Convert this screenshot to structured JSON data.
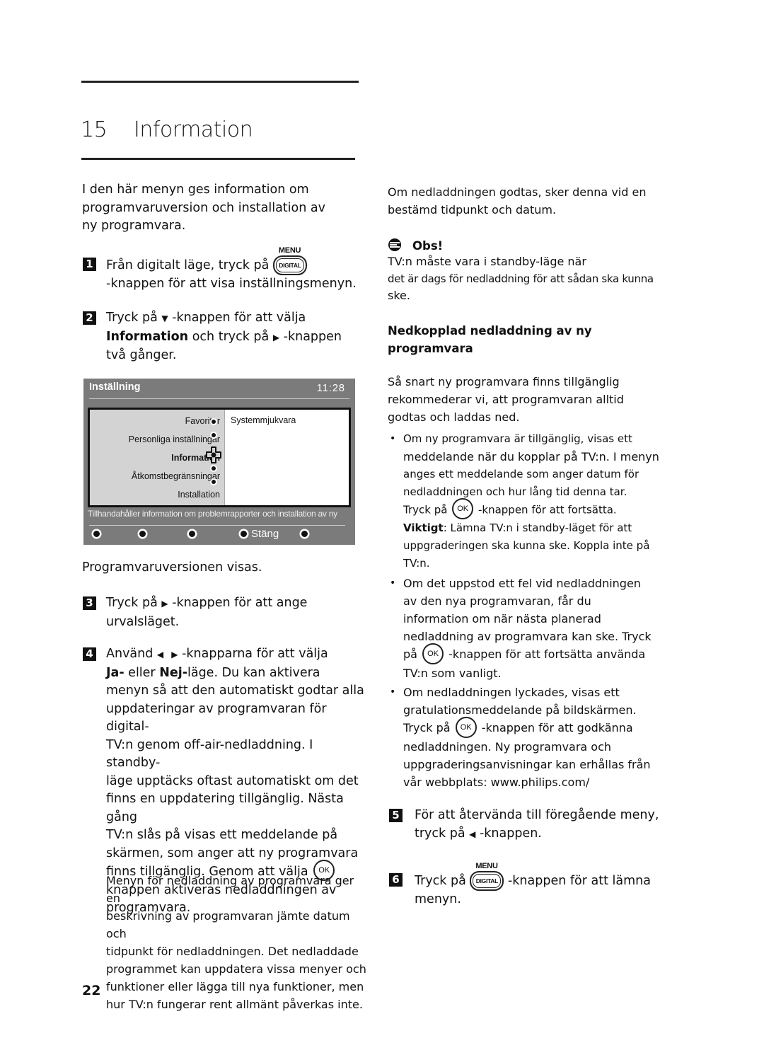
{
  "chapter": {
    "number": "15",
    "title": "Information"
  },
  "intro": [
    "I den här menyn ges information om",
    "programvaruversion och installation av",
    "ny programvara."
  ],
  "keys": {
    "menu_label": "MENU",
    "digital_label": "DIGITAL",
    "ok_label": "OK"
  },
  "steps": {
    "s1": {
      "num": "1",
      "text_a": "Från digitalt läge, tryck på",
      "text_b": "-knappen för att visa inställningsmenyn."
    },
    "s2": {
      "num": "2",
      "text_a": "Tryck på",
      "arrow": "▼",
      "text_b": "-knappen för att välja",
      "bold": "Information",
      "text_c": "och tryck på",
      "arrow2": "▶",
      "text_d": "-knappen",
      "text_e": "två gånger."
    },
    "after_screen": "Programvaruversionen visas.",
    "s3": {
      "num": "3",
      "text_a": "Tryck på",
      "arrow": "▶",
      "text_b": "-knappen för att ange",
      "text_c": "urvalsläget."
    },
    "s4": {
      "num": "4",
      "text_a": "Använd",
      "arrow_l": "◀",
      "arrow_r": "▶",
      "text_b": "-knapparna för att välja",
      "bold_ja": "Ja-",
      "text_c": "eller",
      "bold_nej": "Nej-",
      "text_d": "läge. Du kan aktivera",
      "lines": [
        "menyn så att den automatiskt godtar alla",
        "uppdateringar av programvaran för digital-",
        "TV:n genom off-air-nedladdning. I standby-",
        "läge upptäcks oftast automatiskt om det",
        "finns en uppdatering tillgänglig. Nästa gång",
        "TV:n slås på visas ett meddelande på",
        "skärmen, som anger att ny programvara"
      ],
      "text_ok_a": "finns tillgänglig. Genom att välja",
      "lines2": [
        "knappen aktiveras nedladdningen av",
        "programvara."
      ]
    },
    "menu_para": [
      "Menyn för nedladdning av programvara ger en",
      "beskrivning av programvaran jämte datum och",
      "tidpunkt för nedladdningen. Det nedladdade",
      "programmet kan uppdatera vissa menyer och",
      "funktioner eller lägga till nya funktioner, men",
      "hur TV:n fungerar rent allmänt påverkas inte."
    ],
    "s5": {
      "num": "5",
      "text_a": "För att återvända till föregående meny,",
      "text_b": "tryck på",
      "arrow": "◀",
      "text_c": "-knappen."
    },
    "s6": {
      "num": "6",
      "text_a": "Tryck på",
      "text_b": "-knappen för att lämna",
      "text_c": "menyn."
    }
  },
  "tv_screen": {
    "title": "Inställning",
    "clock": "11:28",
    "menu_items": [
      "Favoriter",
      "Personliga inställningar",
      "Information",
      "Åtkomstbegränsningar",
      "Installation"
    ],
    "active_item": "Information",
    "submenu_item": "Systemmjukvara",
    "description": "Tillhandahåller information om problemrapporter och installation av ny",
    "close_label": "Stäng"
  },
  "right": {
    "p1": [
      "Om nedladdningen godtas, sker denna vid en",
      "bestämd tidpunkt och datum."
    ],
    "obs_title": "Obs!",
    "obs_text": [
      "TV:n måste vara i standby-läge när",
      "det är dags för nedladdning för att sådan ska kunna",
      "ske."
    ],
    "heading": [
      "Nedkopplad nedladdning av ny",
      "programvara"
    ],
    "p2": [
      "Så snart ny programvara finns tillgänglig",
      "rekommederar vi, att programvaran alltid",
      "godtas och laddas ned."
    ],
    "b1": {
      "lines": [
        "Om ny programvara är tillgänglig, visas ett",
        "meddelande när du kopplar på TV:n. I menyn",
        "anges ett meddelande som anger datum för",
        "nedladdningen och hur lång tid denna tar."
      ],
      "ok_a": "Tryck på",
      "ok_b": "-knappen för att fortsätta.",
      "bold": "Viktigt",
      "rest": ": Lämna TV:n i standby-läget för att",
      "lines2": [
        "uppgraderingen ska kunna ske. Koppla inte på",
        "TV:n."
      ]
    },
    "b2": {
      "lines": [
        "Om det uppstod ett fel vid nedladdningen",
        "av den nya programvaran, får du",
        "information om när nästa planerad",
        "nedladdning av programvara kan ske. Tryck"
      ],
      "ok_a": "på",
      "ok_b": "-knappen för att fortsätta använda",
      "last": "TV:n som vanligt."
    },
    "b3": {
      "lines": [
        "Om nedladdningen lyckades, visas ett",
        "gratulationsmeddelande på bildskärmen."
      ],
      "ok_a": "Tryck på",
      "ok_b": "-knappen för att godkänna",
      "lines2": [
        "nedladdningen. Ny programvara och",
        "uppgraderingsanvisningar kan erhållas från",
        "vår webbplats: www.philips.com/"
      ]
    }
  },
  "bullet": "•",
  "page_number": "22"
}
